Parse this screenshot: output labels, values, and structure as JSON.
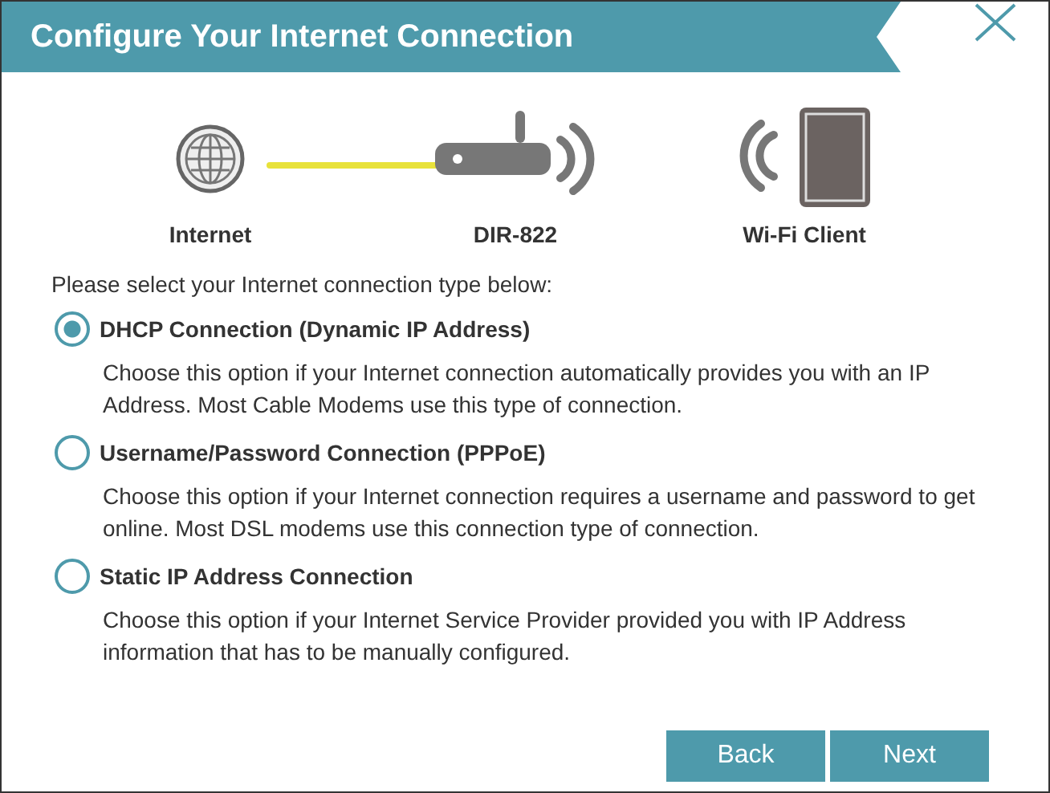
{
  "dialog": {
    "title": "Configure Your Internet Connection"
  },
  "diagram": {
    "nodes": [
      {
        "kind": "globe",
        "label": "Internet"
      },
      {
        "kind": "router",
        "label": "DIR-822"
      },
      {
        "kind": "client",
        "label": "Wi-Fi Client"
      }
    ]
  },
  "prompt": "Please select your Internet connection type below:",
  "options": [
    {
      "label": "DHCP Connection (Dynamic IP Address)",
      "description": "Choose this option if your Internet connection automatically provides you with an IP Address. Most Cable Modems use this type of connection.",
      "selected": true
    },
    {
      "label": "Username/Password Connection (PPPoE)",
      "description": "Choose this option if your Internet connection requires a username and password to get online. Most DSL modems use this connection type of connection.",
      "selected": false
    },
    {
      "label": "Static IP Address Connection",
      "description": "Choose this option if your Internet Service Provider provided you with IP Address information that has to be manually configured.",
      "selected": false
    }
  ],
  "buttons": [
    "Back",
    "Next"
  ]
}
